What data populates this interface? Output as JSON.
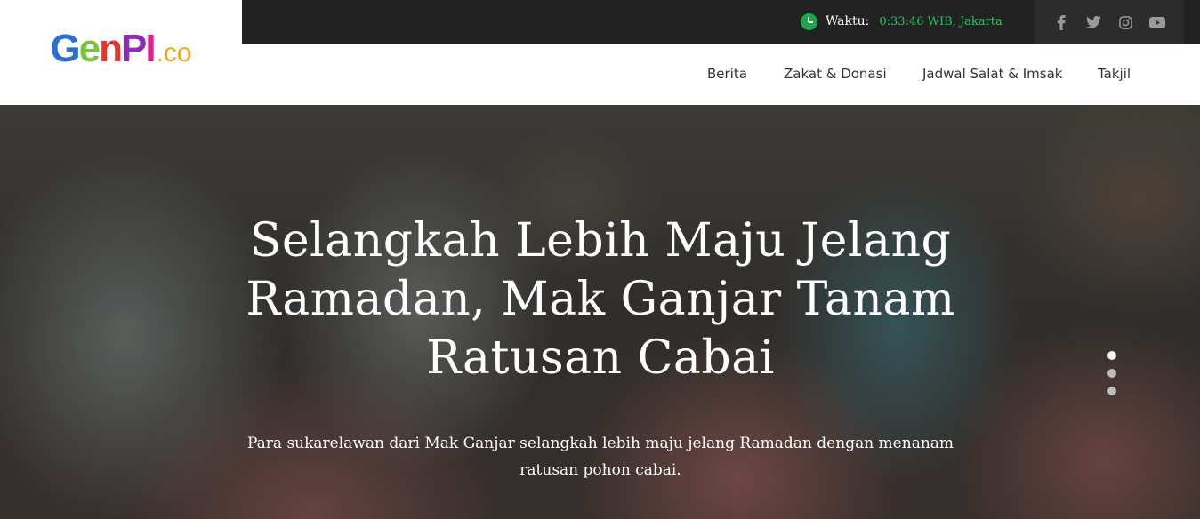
{
  "brand": {
    "logo_parts": [
      "G",
      "e",
      "n",
      "P",
      "I",
      ".co"
    ]
  },
  "topbar": {
    "time_label": "Waktu:",
    "time_value": "0:33:46 WIB, Jakarta",
    "time_icon": "clock-icon",
    "social": [
      {
        "name": "facebook-icon",
        "glyph": "f"
      },
      {
        "name": "twitter-icon",
        "glyph": "t"
      },
      {
        "name": "instagram-icon",
        "glyph": "ig"
      },
      {
        "name": "youtube-icon",
        "glyph": "yt"
      }
    ]
  },
  "nav": {
    "items": [
      "Berita",
      "Zakat & Donasi",
      "Jadwal Salat & Imsak",
      "Takjil"
    ]
  },
  "hero": {
    "title": "Selangkah Lebih Maju Jelang Ramadan, Mak Ganjar Tanam Ratusan Cabai",
    "description": "Para sukarelawan dari Mak Ganjar selangkah lebih maju jelang Ramadan dengan menanam ratusan pohon cabai.",
    "slide_count": 3,
    "active_slide": 1
  },
  "colors": {
    "topbar_bg": "#222222",
    "time_accent": "#22c55e",
    "clock_icon": "#1ba84a"
  }
}
